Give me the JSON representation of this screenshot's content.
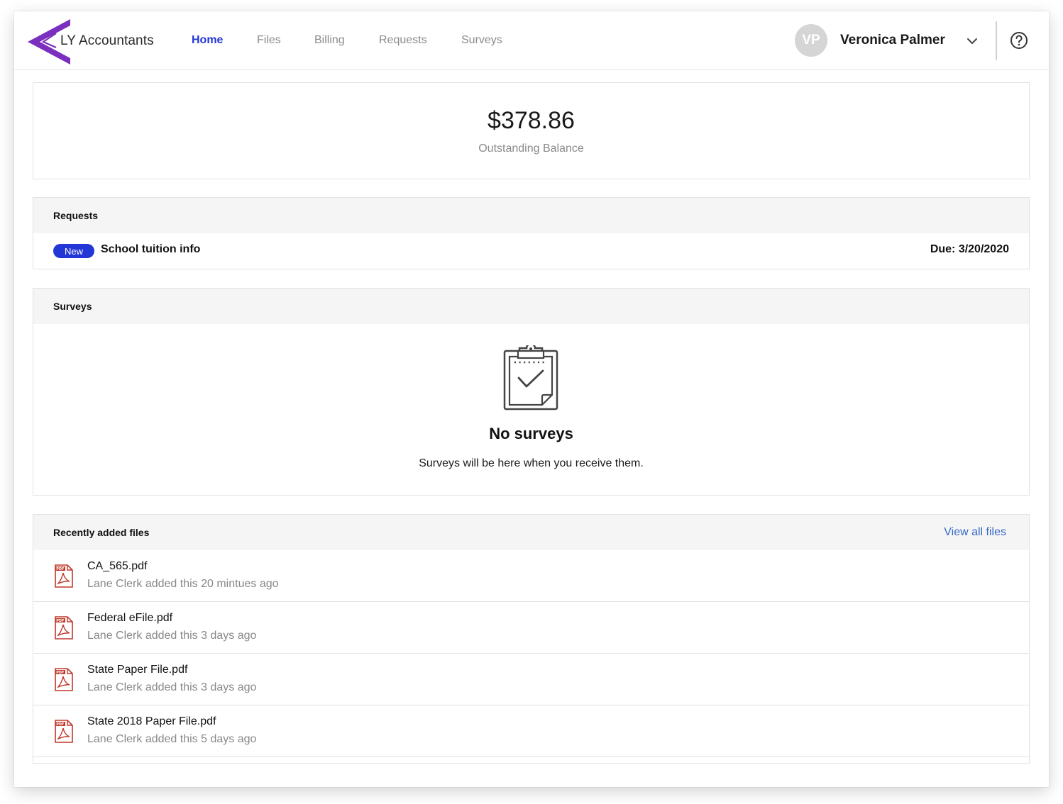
{
  "brand": {
    "name": "LY Accountants",
    "accent_color": "#7b2fbe"
  },
  "nav": {
    "items": [
      {
        "label": "Home",
        "active": true
      },
      {
        "label": "Files",
        "active": false
      },
      {
        "label": "Billing",
        "active": false
      },
      {
        "label": "Requests",
        "active": false
      },
      {
        "label": "Surveys",
        "active": false
      }
    ],
    "active_color": "#2336d6"
  },
  "user": {
    "initials": "VP",
    "name": "Veronica Palmer",
    "menu_icon": "chevron-down-icon",
    "help_icon": "help-circle-icon"
  },
  "balance": {
    "amount": "$378.86",
    "label": "Outstanding Balance"
  },
  "requests": {
    "heading": "Requests",
    "items": [
      {
        "badge": "New",
        "title": "School tuition info",
        "due": "Due: 3/20/2020"
      }
    ]
  },
  "surveys": {
    "heading": "Surveys",
    "empty_icon": "clipboard-check-icon",
    "empty_title": "No surveys",
    "empty_text": "Surveys will be here when you receive them."
  },
  "files": {
    "heading": "Recently added files",
    "view_all_label": "View all files",
    "file_icon": "pdf-file-icon",
    "items": [
      {
        "name": "CA_565.pdf",
        "meta": "Lane Clerk added this 20 mintues ago"
      },
      {
        "name": "Federal eFile.pdf",
        "meta": "Lane Clerk added this 3 days ago"
      },
      {
        "name": "State Paper File.pdf",
        "meta": "Lane Clerk added this 3 days ago"
      },
      {
        "name": "State 2018 Paper File.pdf",
        "meta": "Lane Clerk added this 5 days ago"
      }
    ]
  }
}
